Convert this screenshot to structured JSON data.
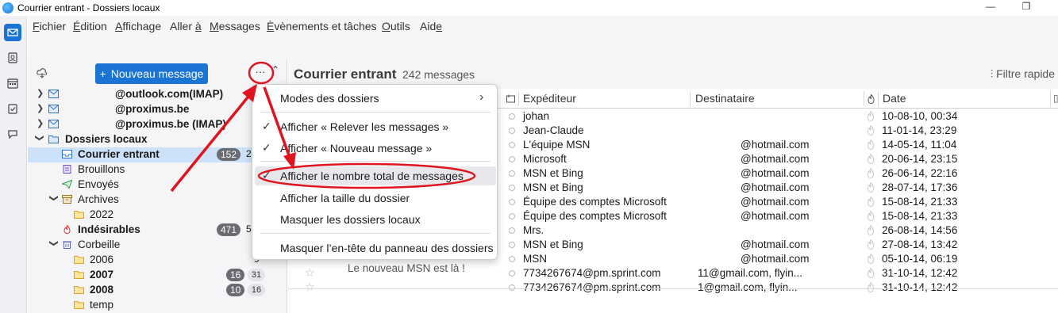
{
  "window": {
    "title": "Courrier entrant - Dossiers locaux",
    "minimize": "—",
    "maximize": "❐"
  },
  "menubar": [
    {
      "pre": "",
      "u": "F",
      "post": "ichier"
    },
    {
      "pre": "",
      "u": "É",
      "post": "dition"
    },
    {
      "pre": "",
      "u": "A",
      "post": "ffichage"
    },
    {
      "pre": "Aller ",
      "u": "à",
      "post": ""
    },
    {
      "pre": "",
      "u": "M",
      "post": "essages"
    },
    {
      "pre": "",
      "u": "È",
      "post": "vènements et tâches"
    },
    {
      "pre": "",
      "u": "O",
      "post": "utils"
    },
    {
      "pre": "Aid",
      "u": "e",
      "post": ""
    }
  ],
  "folderpane": {
    "new_message": "Nouveau message",
    "new_message_plus": "+",
    "more": "···",
    "collapse": "⌃",
    "accounts": [
      {
        "label": "@outlook.com(IMAP)"
      },
      {
        "label": "@proximus.be"
      },
      {
        "label": "@proximus.be (IMAP)"
      }
    ],
    "local_folders": "Dossiers locaux",
    "folders": {
      "inbox": {
        "label": "Courrier entrant",
        "count": "152",
        "total": "2"
      },
      "drafts": {
        "label": "Brouillons"
      },
      "sent": {
        "label": "Envoyés"
      },
      "archives": {
        "label": "Archives"
      },
      "archives_2022": {
        "label": "2022"
      },
      "junk": {
        "label": "Indésirables",
        "count": "471",
        "total": "5"
      },
      "trash": {
        "label": "Corbeille"
      },
      "y2006": {
        "label": "2006",
        "total": "9"
      },
      "y2007": {
        "label": "2007",
        "count": "16",
        "total": "31"
      },
      "y2008": {
        "label": "2008",
        "count": "10",
        "total": "16"
      },
      "temp": {
        "label": "temp"
      }
    }
  },
  "list": {
    "title": "Courrier entrant",
    "count": "242 messages",
    "quick_filter": "Filtre rapide",
    "columns": {
      "from": "Expéditeur",
      "to": "Destinataire",
      "date": "Date"
    },
    "subject_fragment": "Le nouveau MSN est là !",
    "rows": [
      {
        "from": "johan",
        "to": "",
        "date": "10-08-10, 00:34"
      },
      {
        "from": "Jean-Claude",
        "to": "",
        "date": "11-01-14, 23:29"
      },
      {
        "from": "L'équipe MSN",
        "to": "@hotmail.com",
        "date": "14-05-14, 11:04"
      },
      {
        "from": "Microsoft",
        "to": "@hotmail.com",
        "date": "20-06-14, 23:15"
      },
      {
        "from": "MSN et Bing",
        "to": "@hotmail.com",
        "date": "26-06-14, 22:16"
      },
      {
        "from": "MSN et Bing",
        "to": "@hotmail.com",
        "date": "28-07-14, 17:36"
      },
      {
        "from": "Équipe des comptes Microsoft",
        "to": "@hotmail.com",
        "date": "15-08-14, 21:33"
      },
      {
        "from": "Équipe des comptes Microsoft",
        "to": "@hotmail.com",
        "date": "15-08-14, 21:33"
      },
      {
        "from": "Mrs.",
        "to": "",
        "date": "26-08-14, 14:56"
      },
      {
        "from": "MSN et Bing",
        "to": "@hotmail.com",
        "date": "27-08-14, 13:42"
      },
      {
        "from": "MSN",
        "to": "@hotmail.com",
        "date": "05-10-14, 06:19"
      },
      {
        "from": "7734267674@pm.sprint.com",
        "to": "11@gmail.com, flyin...",
        "date": "31-10-14, 12:42"
      },
      {
        "from": "7734267674@pm.sprint.com",
        "to": "1@gmail.com, flyin...",
        "date": "31-10-14, 12:42"
      }
    ]
  },
  "menu": {
    "folder_modes": "Modes des dossiers",
    "show_get_messages": "Afficher « Relever les messages »",
    "show_new_message": "Afficher « Nouveau message »",
    "show_total": "Afficher le nombre total de messages",
    "show_size": "Afficher la taille du dossier",
    "hide_local": "Masquer les dossiers locaux",
    "hide_header": "Masquer l’en-tête du panneau des dossiers",
    "check": "✓",
    "arrow": "›"
  },
  "colors": {
    "accent": "#1b73d4",
    "annotation": "#e0141e",
    "selection": "#cde2f8"
  }
}
